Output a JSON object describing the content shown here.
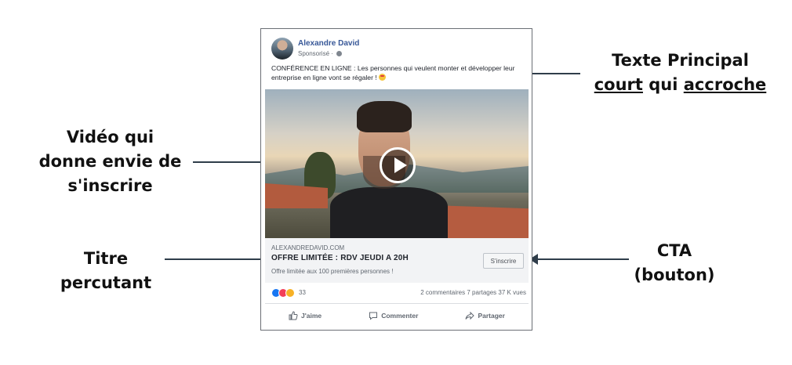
{
  "post": {
    "author": "Alexandre David",
    "sponsored": "Sponsorisé ·",
    "text": "CONFÉRENCE EN LIGNE : Les personnes qui veulent monter et développer leur entreprise en ligne vont se régaler !",
    "link_domain": "ALEXANDREDAVID.COM",
    "headline": "OFFRE LIMITÉE : RDV JEUDI A 20H",
    "description": "Offre limitée aux 100 premières personnes !",
    "cta_label": "S'inscrire",
    "reaction_count": "33",
    "comments": "2 commentaires",
    "shares": "7 partages",
    "views": "37 K vues",
    "actions": {
      "like": "J'aime",
      "comment": "Commenter",
      "share": "Partager"
    }
  },
  "annotations": {
    "main_text": {
      "line1": "Texte Principal",
      "line2_a": "court",
      "line2_b": " qui ",
      "line2_c": "accroche"
    },
    "video": {
      "line1": "Vidéo qui",
      "line2": "donne envie de",
      "line3": "s'inscrire"
    },
    "headline": {
      "line1": "Titre",
      "line2": "percutant"
    },
    "cta": {
      "line1": "CTA",
      "line2": "(bouton)"
    }
  },
  "icons": [
    "globe-icon",
    "play-icon",
    "like-reaction-icon",
    "love-reaction-icon",
    "haha-reaction-icon",
    "thumbs-up-icon",
    "comment-icon",
    "share-icon",
    "smiling-face-emoji"
  ]
}
